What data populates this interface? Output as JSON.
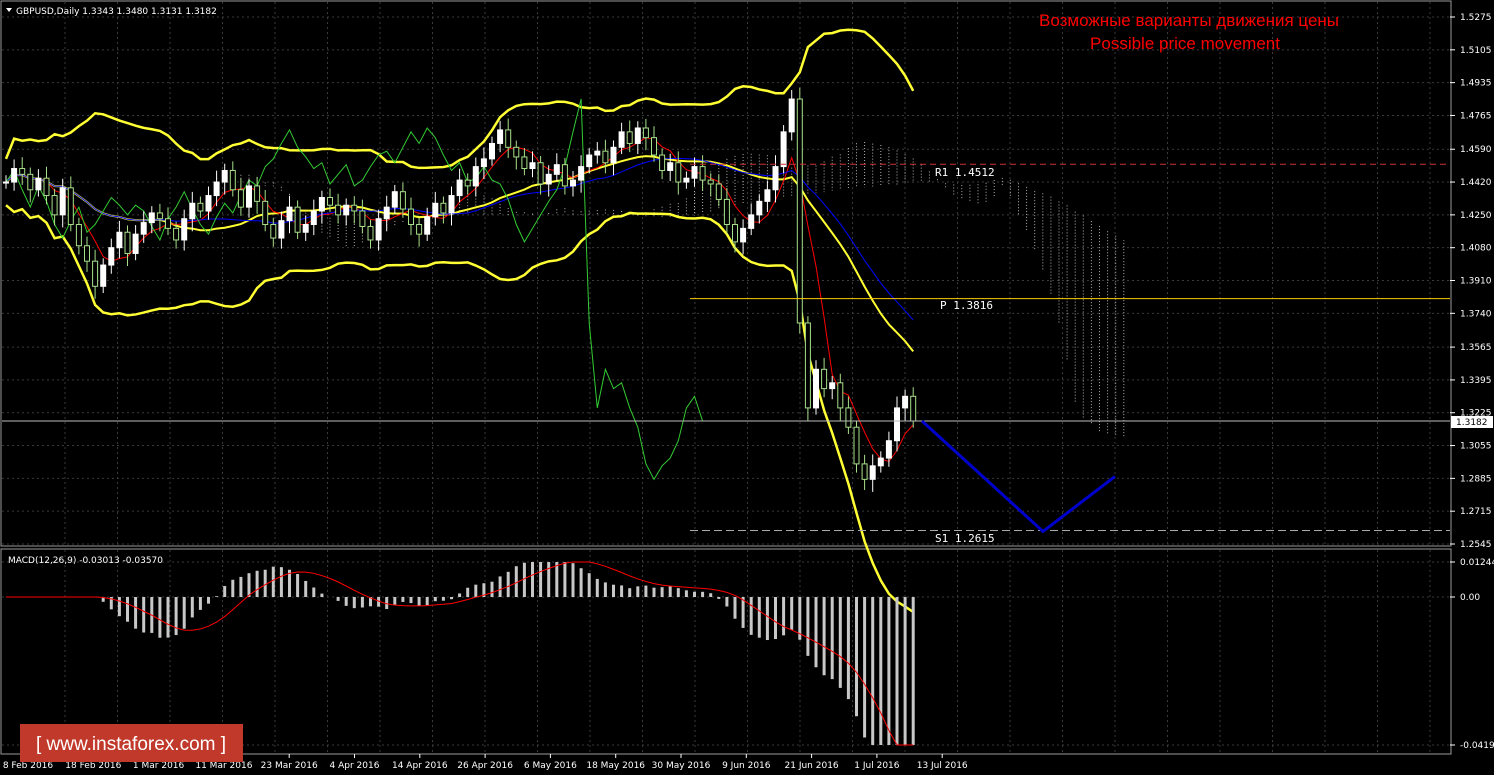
{
  "header": {
    "symbol_line": "GBPUSD,Daily  1.3343 1.3480 1.3131 1.3182",
    "overlay_title_ru": "Возможные варианты движения цены",
    "overlay_title_en": "Possible price movement"
  },
  "colors": {
    "background": "#000000",
    "grid": "#3a3a3a",
    "axis": "#ffffff",
    "bull_candle": "#ffffff",
    "bear_candle": "#a8e08a",
    "bollinger": "#ffff33",
    "fast_ma": "#ff0000",
    "slow_ma": "#0000ff",
    "chikou": "#33cc33",
    "kumo": "#ffffff",
    "pivot_p": "#ffcc00",
    "pivot_rs": "#cc3333",
    "projection": "#0000cc",
    "macd_hist": "#c8c8c8",
    "macd_signal": "#ff0000",
    "watermark_bg": "#c0392b",
    "title_red": "#ff0000"
  },
  "price_axis": {
    "ticks": [
      "1.5275",
      "1.5105",
      "1.4935",
      "1.4765",
      "1.4590",
      "1.4420",
      "1.4250",
      "1.4080",
      "1.3910",
      "1.3740",
      "1.3565",
      "1.3395",
      "1.3225",
      "1.3055",
      "1.2885",
      "1.2715",
      "1.2545"
    ],
    "current_price_label": "1.3182"
  },
  "macd_axis": {
    "ticks": [
      "0.01244",
      "0.00",
      "-0.04191"
    ]
  },
  "time_axis": {
    "labels": [
      "8 Feb 2016",
      "18 Feb 2016",
      "1 Mar 2016",
      "11 Mar 2016",
      "23 Mar 2016",
      "4 Apr 2016",
      "14 Apr 2016",
      "26 Apr 2016",
      "6 May 2016",
      "18 May 2016",
      "30 May 2016",
      "9 Jun 2016",
      "21 Jun 2016",
      "1 Jul 2016",
      "13 Jul 2016"
    ]
  },
  "levels": {
    "r1": "R1  1.4512",
    "p": "P  1.3816",
    "s1": "S1  1.2615"
  },
  "macd_panel": {
    "label": "MACD(12,26,9) -0.03013 -0.03570"
  },
  "watermark": {
    "text": "[ www.instaforex.com ]"
  },
  "chart_data": {
    "type": "candlestick",
    "symbol": "GBPUSD",
    "timeframe": "Daily",
    "ylim": [
      1.2545,
      1.5275
    ],
    "current_price": 1.3182,
    "last_ohlc": {
      "open": 1.3343,
      "high": 1.348,
      "low": 1.3131,
      "close": 1.3182
    },
    "pivot_levels": {
      "R1": 1.4512,
      "P": 1.3816,
      "S1": 1.2615
    },
    "projection": [
      {
        "point": "start",
        "price": 1.3182
      },
      {
        "point": "low",
        "price": 1.261
      },
      {
        "point": "end",
        "price": 1.2895
      }
    ],
    "price_close_series": [
      1.442,
      1.449,
      1.446,
      1.438,
      1.444,
      1.435,
      1.425,
      1.439,
      1.42,
      1.409,
      1.401,
      1.388,
      1.399,
      1.408,
      1.416,
      1.405,
      1.415,
      1.421,
      1.426,
      1.423,
      1.418,
      1.412,
      1.423,
      1.431,
      1.427,
      1.435,
      1.442,
      1.448,
      1.438,
      1.429,
      1.44,
      1.432,
      1.42,
      1.413,
      1.422,
      1.429,
      1.416,
      1.42,
      1.427,
      1.434,
      1.43,
      1.425,
      1.43,
      1.427,
      1.419,
      1.412,
      1.423,
      1.429,
      1.437,
      1.428,
      1.42,
      1.415,
      1.424,
      1.431,
      1.426,
      1.435,
      1.443,
      1.44,
      1.45,
      1.454,
      1.462,
      1.469,
      1.46,
      1.455,
      1.449,
      1.452,
      1.441,
      1.446,
      1.451,
      1.44,
      1.443,
      1.45,
      1.456,
      1.458,
      1.452,
      1.46,
      1.468,
      1.462,
      1.47,
      1.465,
      1.456,
      1.448,
      1.452,
      1.442,
      1.444,
      1.45,
      1.443,
      1.441,
      1.433,
      1.42,
      1.411,
      1.418,
      1.425,
      1.432,
      1.438,
      1.45,
      1.468,
      1.485,
      1.369,
      1.325,
      1.345,
      1.335,
      1.338,
      1.325,
      1.315,
      1.296,
      1.288,
      1.295,
      1.299,
      1.308,
      1.325,
      1.331,
      1.3182
    ],
    "macd": {
      "value": -0.03013,
      "signal": -0.0357
    }
  }
}
